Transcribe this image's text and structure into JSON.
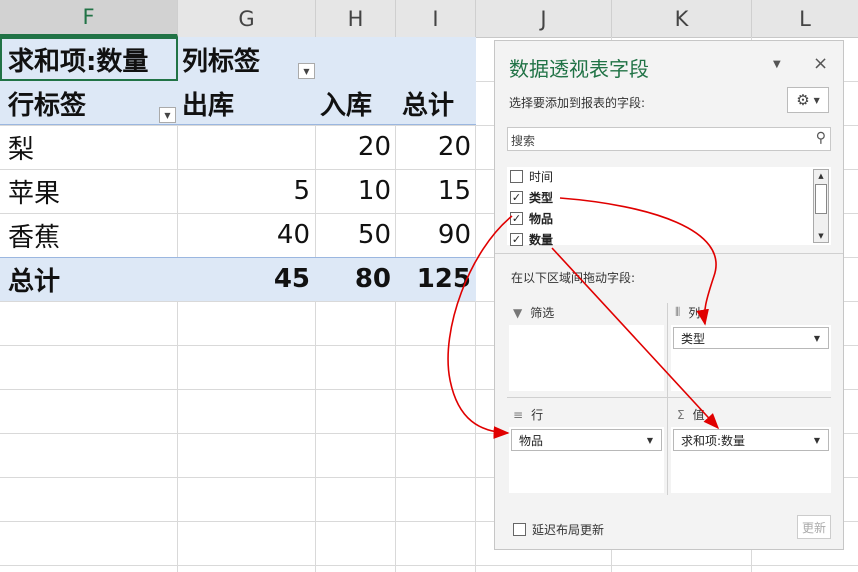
{
  "columns": [
    "F",
    "G",
    "H",
    "I",
    "J",
    "K",
    "L"
  ],
  "pivot": {
    "header_value": "求和项:数量",
    "header_columns": "列标签",
    "row_label": "行标签",
    "col_out": "出库",
    "col_in": "入库",
    "col_total": "总计",
    "rows": [
      {
        "name": "梨",
        "out": "",
        "in": "20",
        "total": "20"
      },
      {
        "name": "苹果",
        "out": "5",
        "in": "10",
        "total": "15"
      },
      {
        "name": "香蕉",
        "out": "40",
        "in": "50",
        "total": "90"
      }
    ],
    "grand": {
      "name": "总计",
      "out": "45",
      "in": "80",
      "total": "125"
    }
  },
  "pane": {
    "title": "数据透视表字段",
    "choose_label": "选择要添加到报表的字段:",
    "search_placeholder": "搜索",
    "fields": [
      {
        "name": "时间",
        "checked": false,
        "mark": ""
      },
      {
        "name": "类型",
        "checked": true,
        "mark": "✓"
      },
      {
        "name": "物品",
        "checked": true,
        "mark": "✓"
      },
      {
        "name": "数量",
        "checked": true,
        "mark": "✓"
      }
    ],
    "drag_label": "在以下区域间拖动字段:",
    "areas": {
      "filter_label": "筛选",
      "columns_label": "列",
      "rows_label": "行",
      "values_label": "值",
      "columns_field": "类型",
      "rows_field": "物品",
      "values_field": "求和项:数量"
    },
    "defer_label": "延迟布局更新",
    "update_label": "更新"
  },
  "colors": {
    "accent": "#217346",
    "band": "#dde8f6",
    "arrow": "#e00000"
  }
}
